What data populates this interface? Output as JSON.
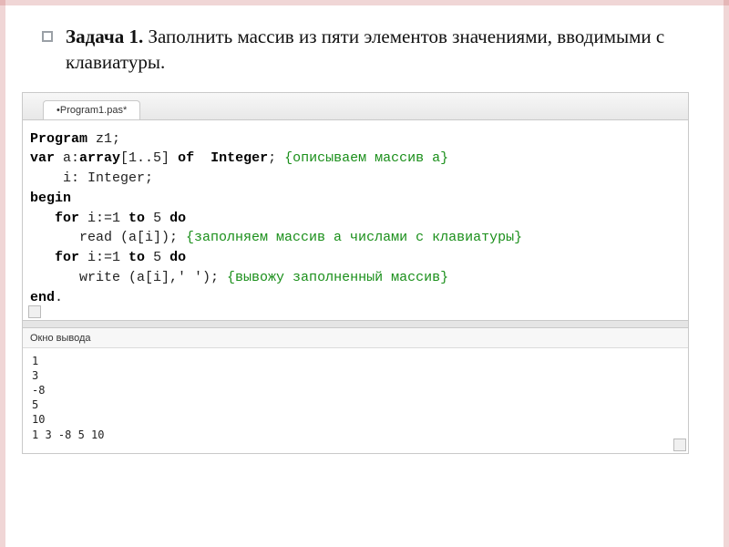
{
  "task": {
    "prefix": "Задача 1.",
    "text": " Заполнить массив из пяти элементов значениями, вводимыми с клавиатуры."
  },
  "tab": {
    "label": "•Program1.pas*"
  },
  "code": {
    "l1_kw": "Program",
    "l1_rest": " z1;",
    "l2_kw": "var",
    "l2_mid": " a:",
    "l2_kw2": "array",
    "l2_mid2": "[1..5] ",
    "l2_kw3": "of",
    "l2_ty": "  Integer",
    "l2_sc": "; ",
    "l2_cm": "{описываем массив a}",
    "l3": "    i: Integer;",
    "l4_kw": "begin",
    "l5_pad": "   ",
    "l5_kw1": "for",
    "l5_mid": " i:=1 ",
    "l5_kw2": "to",
    "l5_mid2": " 5 ",
    "l5_kw3": "do",
    "l6_pad": "      read (a[i]); ",
    "l6_cm": "{заполняем массив a числами с клавиатуры}",
    "l7_pad": "   ",
    "l7_kw1": "for",
    "l7_mid": " i:=1 ",
    "l7_kw2": "to",
    "l7_mid2": " 5 ",
    "l7_kw3": "do",
    "l8_pad": "      write (a[i],' '); ",
    "l8_cm": "{вывожу заполненный массив}",
    "l9_kw": "end",
    "l9_rest": "."
  },
  "output": {
    "title": "Окно вывода",
    "lines": [
      "1",
      "3",
      "-8",
      "5",
      "10",
      "1 3 -8 5 10"
    ]
  }
}
